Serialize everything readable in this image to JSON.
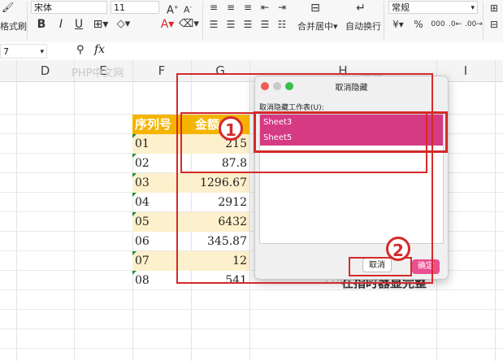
{
  "toolbar": {
    "format_painter_label": "格式刷",
    "font_name": "宋体",
    "font_size": "11",
    "bold": "B",
    "italic": "I",
    "underline": "U",
    "merge_center_label": "合并居中",
    "wrap_text_label": "自动换行",
    "number_format": "常规",
    "currency_symbol": "¥",
    "percent_symbol": "%",
    "thousands_symbol": "000",
    "font_increase": "A",
    "font_decrease": "A",
    "font_color": "A"
  },
  "formula_bar": {
    "fx_label": "fx",
    "name_box": "7"
  },
  "columns": [
    "D",
    "E",
    "F",
    "G",
    "H",
    "I"
  ],
  "table": {
    "headers": [
      "序列号",
      "金额"
    ],
    "rows": [
      {
        "id": "01",
        "amount": "215"
      },
      {
        "id": "02",
        "amount": "87.8"
      },
      {
        "id": "03",
        "amount": "1296.67"
      },
      {
        "id": "04",
        "amount": "2912"
      },
      {
        "id": "05",
        "amount": "6432"
      },
      {
        "id": "06",
        "amount": "345.87"
      },
      {
        "id": "07",
        "amount": "12"
      },
      {
        "id": "08",
        "amount": "541"
      }
    ],
    "overflow_text": "在指时器显完整"
  },
  "watermarks": [
    "PHP中文网",
    "PHP中文网",
    "PHP中文网"
  ],
  "dialog": {
    "title": "取消隐藏",
    "list_label": "取消隐藏工作表(U):",
    "sheets": [
      "Sheet3",
      "Sheet5"
    ],
    "cancel_label": "取消",
    "ok_label": "确定"
  },
  "annotations": {
    "step1": "1",
    "step2": "2"
  },
  "colors": {
    "header_fill": "#f5b400",
    "band_fill": "#fdf0cc",
    "selection": "#d63a83",
    "annotation_red": "#d42a2a"
  }
}
